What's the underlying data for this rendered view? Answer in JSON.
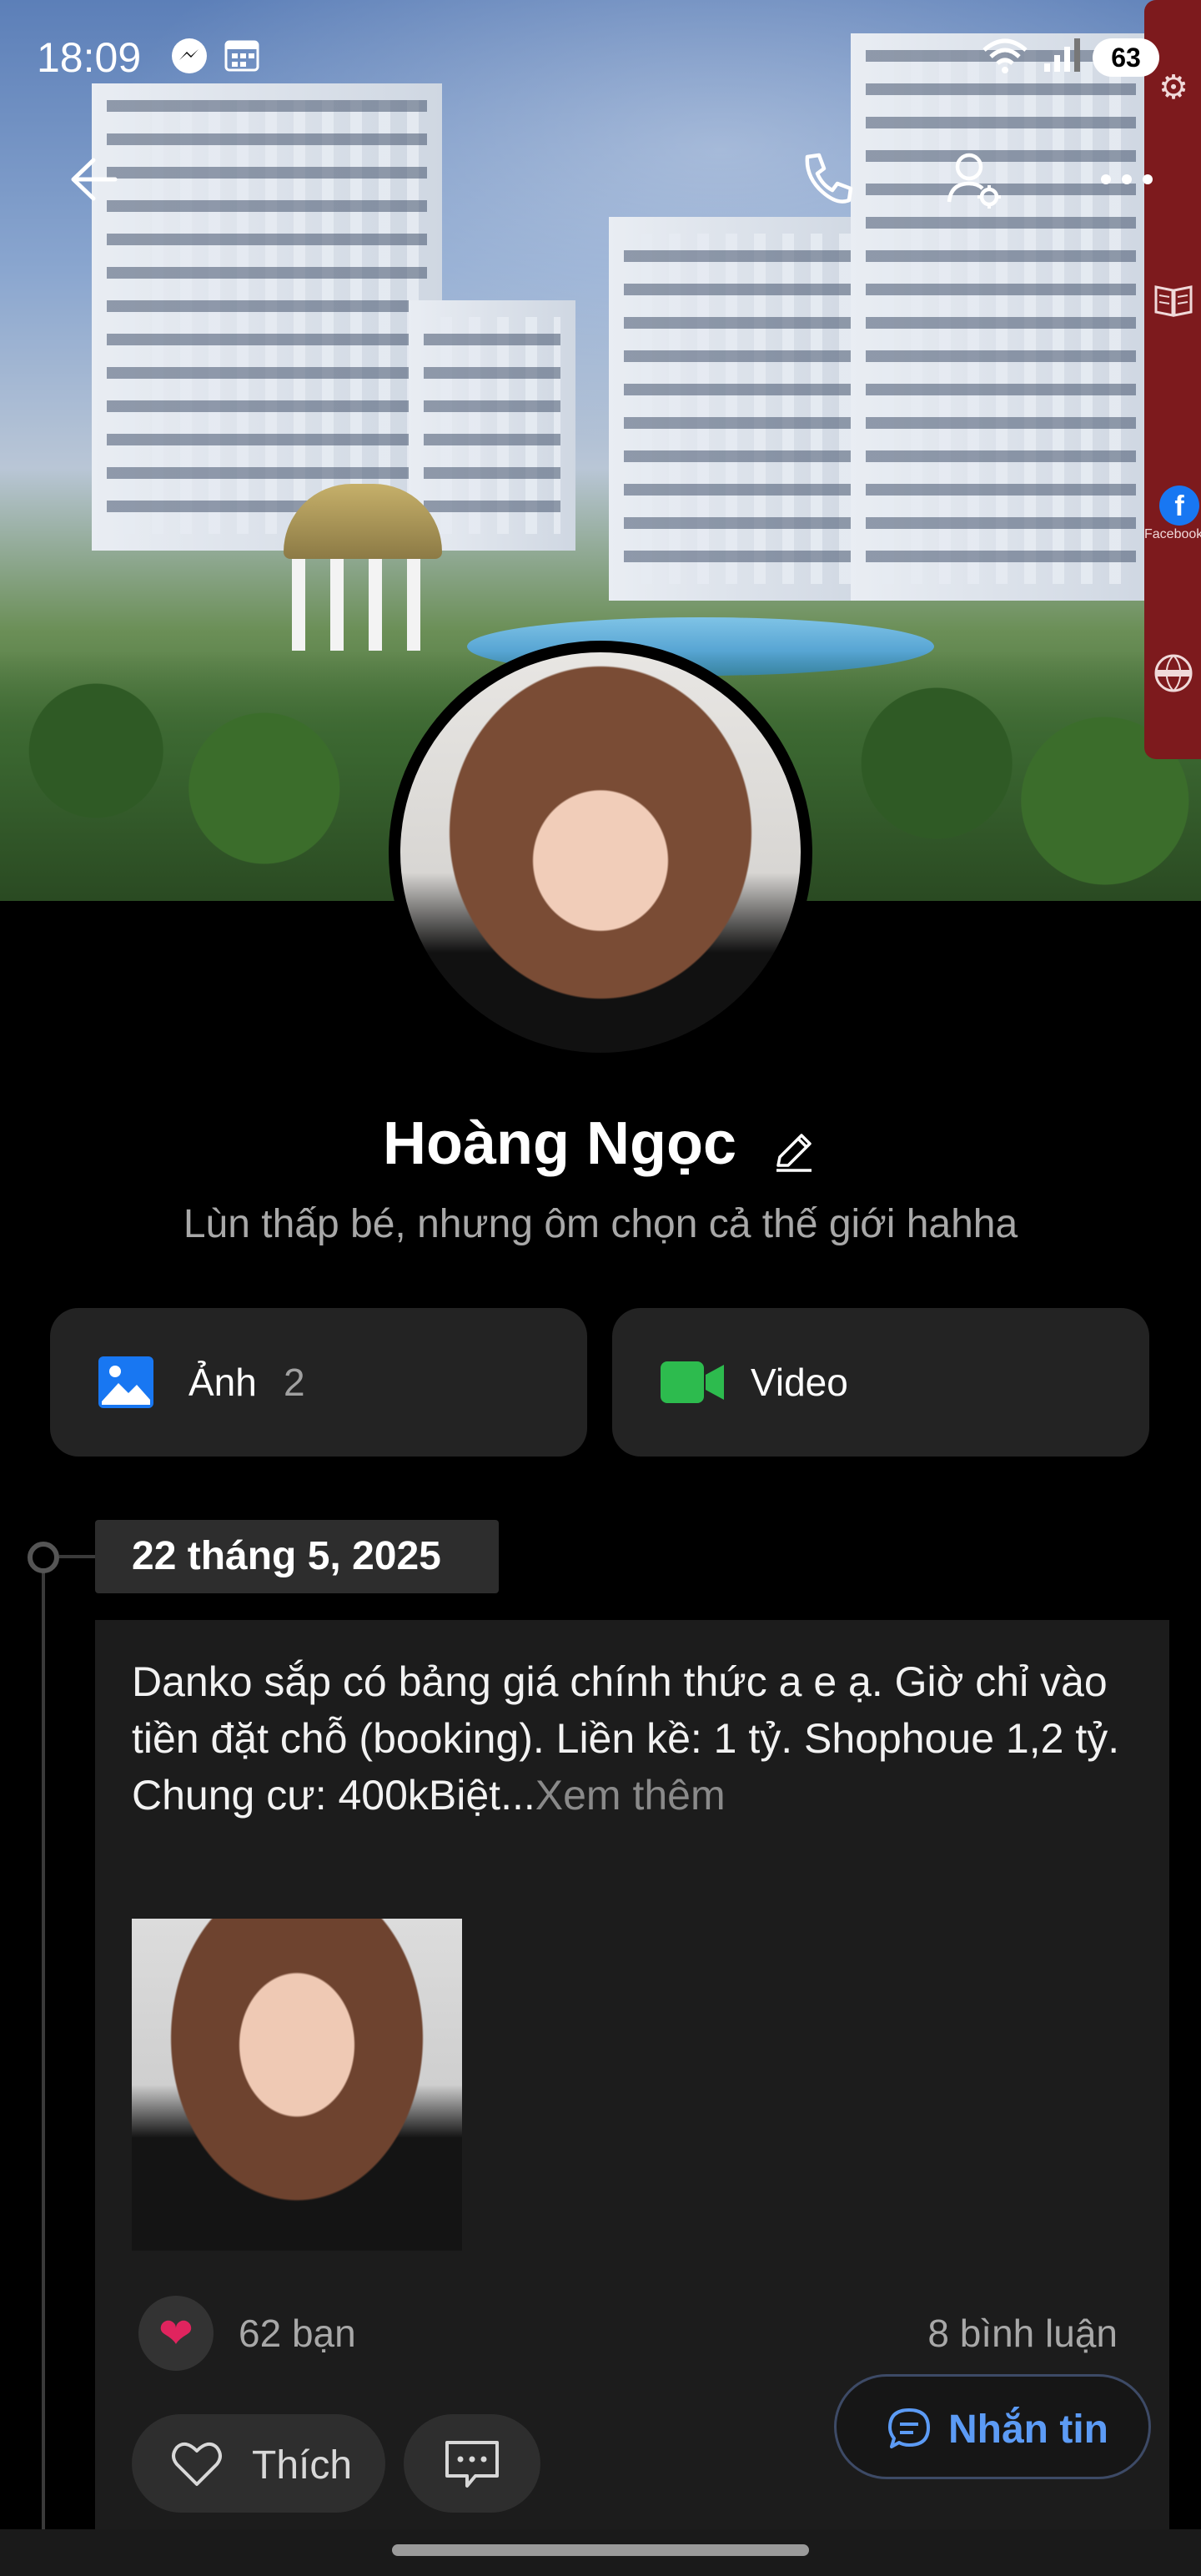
{
  "status_bar": {
    "time": "18:09",
    "battery": "63",
    "icons": [
      "messenger-icon",
      "calendar-icon",
      "wifi-icon",
      "signal-icon"
    ]
  },
  "top_bar": {
    "icons": [
      "back-arrow-icon",
      "phone-icon",
      "user-settings-icon",
      "more-icon"
    ]
  },
  "side_panel": {
    "facebook_label": "Facebook",
    "icons": [
      "gear-icon",
      "book-icon",
      "facebook-icon",
      "globe-icon"
    ],
    "color": "#7d1a1d"
  },
  "profile": {
    "name": "Hoàng Ngọc",
    "bio": "Lùn thấp bé, nhưng ôm chọn cả thế giới hahha"
  },
  "media": {
    "photos_label": "Ảnh",
    "photos_count": "2",
    "video_label": "Video",
    "photos_icon_color": "#1877f2",
    "video_icon_color": "#2dbb4e"
  },
  "timeline": {
    "date": "22 tháng 5, 2025"
  },
  "post": {
    "text": "Danko sắp có bảng giá chính thức a e ạ. Giờ chỉ vào tiền đặt chỗ (booking). Liền kề: 1 tỷ. Shophoue 1,2 tỷ. Chung cư: 400kBiệt...",
    "more": "Xem thêm",
    "reactions": "62 bạn",
    "comments": "8 bình luận",
    "like_label": "Thích"
  },
  "message_button": {
    "label": "Nhắn tin",
    "color": "#5c9bf5"
  }
}
